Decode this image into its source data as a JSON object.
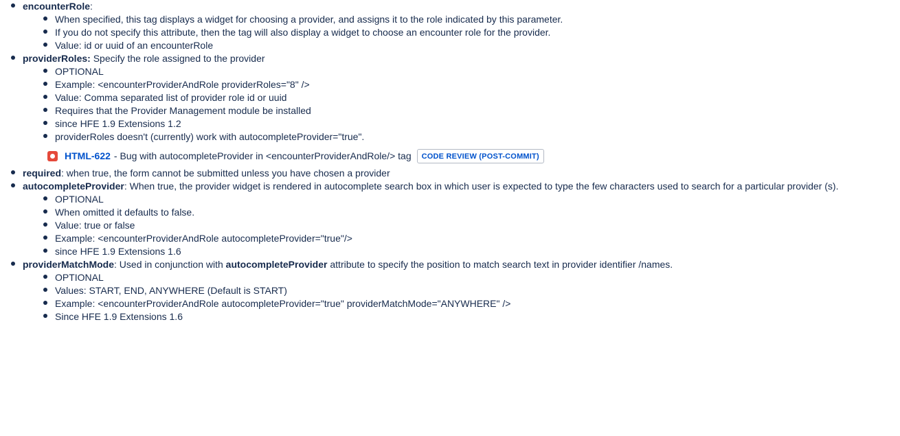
{
  "items": {
    "encounterRole": {
      "term": "encounterRole",
      "sep": ":",
      "sub": [
        "When specified, this tag displays a widget for choosing a provider, and assigns it to the role indicated by this parameter.",
        "If you do not specify this attribute, then the tag will also display a widget to choose an encounter role for the provider.",
        "Value:  id or uuid of an encounterRole"
      ]
    },
    "providerRoles": {
      "term": "providerRoles:",
      "desc": "  Specify the role assigned to the provider",
      "sub": [
        "OPTIONAL",
        "Example:  <encounterProviderAndRole providerRoles=\"8\" />",
        "Value:  Comma separated list of provider role id or uuid",
        "Requires that the Provider Management module be installed",
        "since HFE 1.9 Extensions 1.2",
        "providerRoles doesn't (currently) work with autocompleteProvider=\"true\"."
      ]
    },
    "jira": {
      "key": "HTML-622",
      "summary": " - Bug with autocompleteProvider in <encounterProviderAndRole/> tag",
      "status": "CODE REVIEW (POST-COMMIT)",
      "icon": "bug-icon",
      "icon_color": "#e5493a"
    },
    "required": {
      "term": "required",
      "desc": ": when true, the form cannot be submitted unless you have chosen a provider"
    },
    "autocompleteProvider": {
      "term": "autocompleteProvider",
      "desc": ": When true, the provider widget is rendered in autocomplete search box in which user is expected to type the few characters used to search for a particular provider (s).",
      "sub": [
        "OPTIONAL",
        "When omitted it defaults to false.",
        "Value: true or false",
        "Example: <encounterProviderAndRole autocompleteProvider=\"true\"/>",
        "since HFE 1.9 Extensions 1.6"
      ]
    },
    "providerMatchMode": {
      "term": "providerMatchMode",
      "desc_a": ": Used in conjunction with ",
      "desc_bold": "autocompleteProvider",
      "desc_b": " attribute to specify the position to match search text in provider identifier /names.",
      "sub": [
        "OPTIONAL",
        "Values: START, END, ANYWHERE (Default is START)",
        "Example: <encounterProviderAndRole autocompleteProvider=\"true\" providerMatchMode=\"ANYWHERE\" />",
        "Since HFE 1.9 Extensions 1.6"
      ]
    }
  }
}
